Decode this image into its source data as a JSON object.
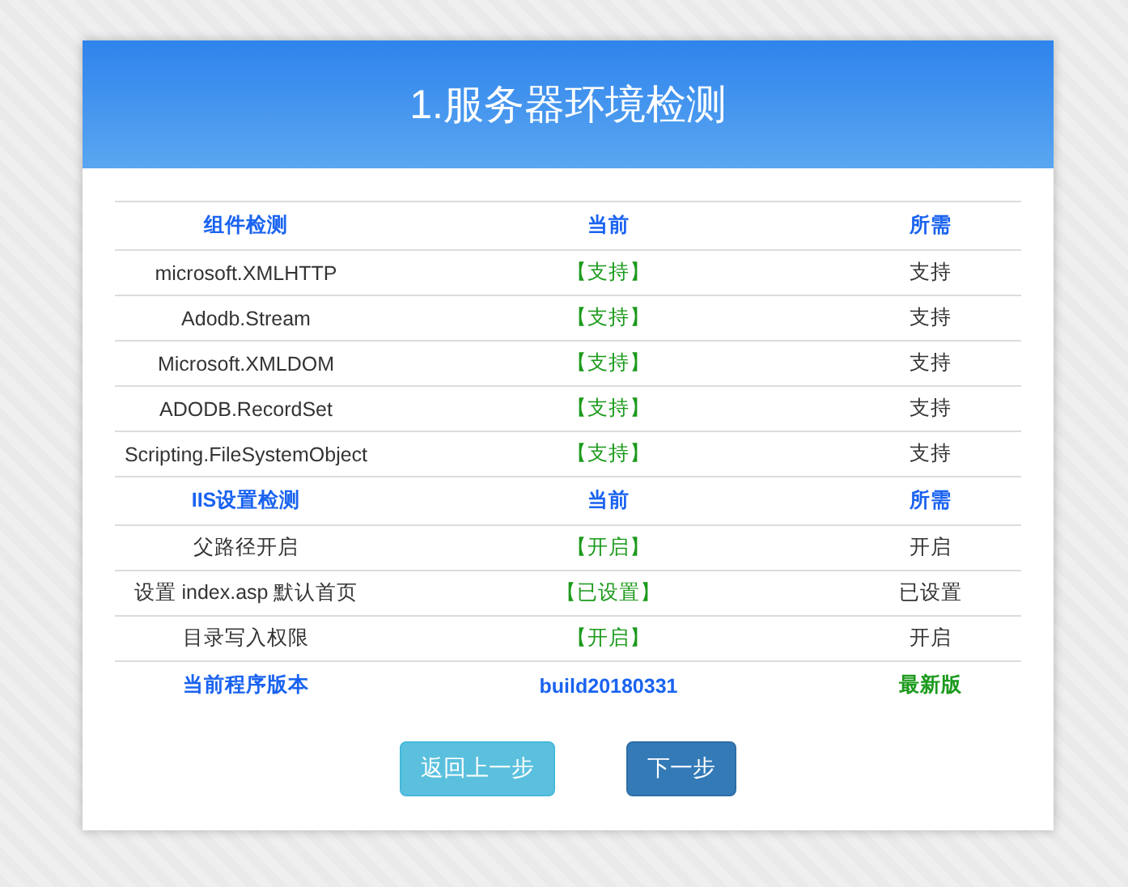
{
  "title": "1.服务器环境检测",
  "rows": [
    {
      "kind": "header",
      "cells": [
        "组件检测",
        "当前",
        "所需"
      ]
    },
    {
      "kind": "item",
      "cells": [
        "microsoft.XMLHTTP",
        "【支持】",
        "支持"
      ]
    },
    {
      "kind": "item",
      "cells": [
        "Adodb.Stream",
        "【支持】",
        "支持"
      ]
    },
    {
      "kind": "item",
      "cells": [
        "Microsoft.XMLDOM",
        "【支持】",
        "支持"
      ]
    },
    {
      "kind": "item",
      "cells": [
        "ADODB.RecordSet",
        "【支持】",
        "支持"
      ]
    },
    {
      "kind": "item",
      "cells": [
        "Scripting.FileSystemObject",
        "【支持】",
        "支持"
      ]
    },
    {
      "kind": "header",
      "cells": [
        "IIS设置检测",
        "当前",
        "所需"
      ]
    },
    {
      "kind": "item",
      "cells": [
        "父路径开启",
        "【开启】",
        "开启"
      ]
    },
    {
      "kind": "item",
      "cells": [
        "设置 index.asp 默认首页",
        "【已设置】",
        "已设置"
      ]
    },
    {
      "kind": "item",
      "cells": [
        "目录写入权限",
        "【开启】",
        "开启"
      ]
    },
    {
      "kind": "version",
      "cells": [
        "当前程序版本",
        "build20180331",
        "最新版"
      ]
    }
  ],
  "buttons": [
    {
      "label": "返回上一步",
      "kind": "secondary"
    },
    {
      "label": "下一步",
      "kind": "primary"
    }
  ]
}
